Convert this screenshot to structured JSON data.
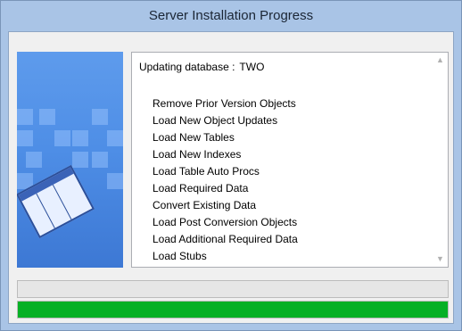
{
  "window": {
    "title": "Server Installation Progress"
  },
  "log": {
    "header_label": "Updating database :",
    "header_value": "TWO",
    "steps": [
      "Remove Prior Version Objects",
      "Load New Object Updates",
      "Load New Tables",
      "Load New Indexes",
      "Load Table Auto Procs",
      "Load Required Data",
      "Convert Existing Data",
      "Load Post Conversion Objects",
      "Load Additional Required Data",
      "Load Stubs"
    ]
  },
  "progress": {
    "step_progress": 0.0,
    "overall_progress": 1.0,
    "fill_color": "#06b025"
  },
  "icons": {
    "scroll_up": "chevron-up-icon",
    "scroll_down": "chevron-down-icon",
    "illustration": "database-table-illustration"
  }
}
